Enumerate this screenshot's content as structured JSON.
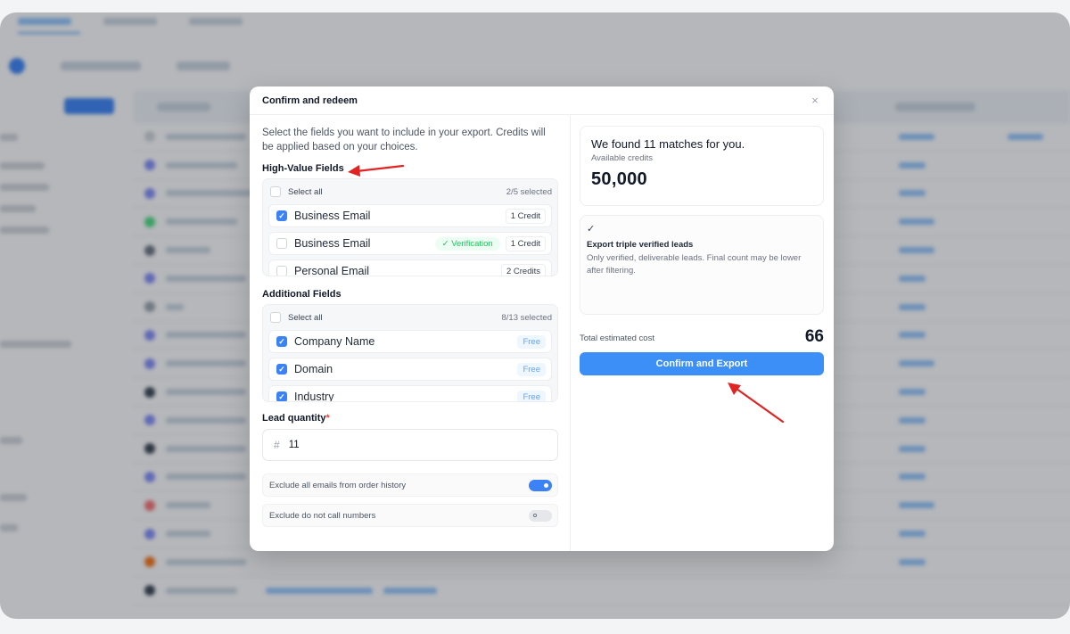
{
  "modal": {
    "title": "Confirm and redeem",
    "intro": "Select the fields you want to include in your export. Credits will be applied based on your choices."
  },
  "high_value": {
    "title": "High-Value Fields",
    "select_all": "Select all",
    "selected_count": "2/5 selected",
    "items": [
      {
        "label": "Business Email",
        "checked": true,
        "cost": "1 Credit"
      },
      {
        "label": "Business Email",
        "checked": false,
        "badge": "Verification",
        "cost": "1 Credit"
      },
      {
        "label": "Personal Email",
        "checked": false,
        "cost": "2 Credits"
      }
    ]
  },
  "additional": {
    "title": "Additional Fields",
    "select_all": "Select all",
    "selected_count": "8/13 selected",
    "items": [
      {
        "label": "Company Name",
        "checked": true,
        "cost": "Free"
      },
      {
        "label": "Domain",
        "checked": true,
        "cost": "Free"
      },
      {
        "label": "Industry",
        "checked": true,
        "cost": "Free"
      }
    ]
  },
  "lead_quantity": {
    "label": "Lead quantity",
    "required_mark": "*",
    "prefix": "#",
    "value": "11"
  },
  "toggles": [
    {
      "label": "Exclude all emails from order history",
      "on": true
    },
    {
      "label": "Exclude do not call numbers",
      "on": false
    }
  ],
  "summary": {
    "match_text": "We found 11 matches for you.",
    "credits_label": "Available credits",
    "credits_value": "50,000",
    "triple_check": "✓",
    "triple_title": "Export triple verified leads",
    "triple_desc": "Only verified, deliverable leads. Final count may be lower after filtering.",
    "cost_label": "Total estimated cost",
    "cost_value": "66",
    "confirm_label": "Confirm and Export"
  },
  "icons": {
    "close": "×",
    "check": "✓",
    "verification": "✓"
  },
  "colors": {
    "accent": "#3b8ff6",
    "annotation": "#e02424",
    "verification": "#22c55e"
  }
}
